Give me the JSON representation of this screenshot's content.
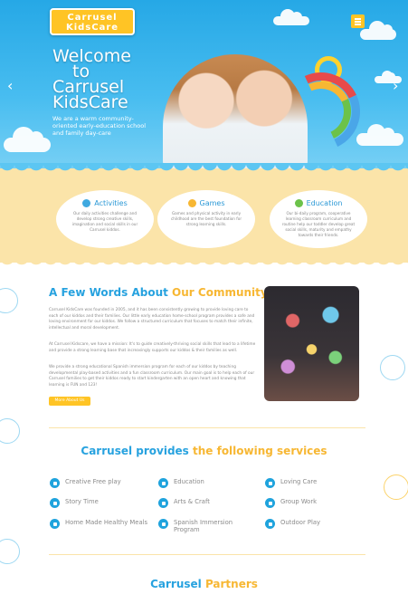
{
  "header": {
    "logo_line1": "Carrusel",
    "logo_line2": "KidsCare"
  },
  "hero": {
    "title_lines": [
      "Welcome",
      "to",
      "Carrusel",
      "KidsCare"
    ],
    "subtitle": "We are a warm community-oriented early-education school and family day-care"
  },
  "features": [
    {
      "title": "Activities",
      "text": "Our daily activities challenge and develop strong creative skills, imagination and social skills in our Carrusel kiddos.",
      "color": "#3fa9e0"
    },
    {
      "title": "Games",
      "text": "Games and physical activity in early childhood are the best foundation for strong learning skills.",
      "color": "#f7b733"
    },
    {
      "title": "Education",
      "text": "Our bi-daily program, cooperative learning classroom curriculum and routine help our toddler develop great social skills, maturity and empathy towards their friends.",
      "color": "#6cc24a"
    }
  ],
  "about": {
    "title_start": "A Few Words About ",
    "title_highlight": "Our Community",
    "paragraphs": [
      "Carrusel KidsCare was founded in 2005, and it has been consistently growing to provide loving care to each of our kiddos and their families. Our little early education home-school program provides a safe and loving environment for our kiddos. We follow a structured curriculum that focuses to match their infinite, intellectual and moral development.",
      "At Carrusel Kidscare, we have a mission: It's to guide creatively-thriving social skills that lead to a lifetime and provide a strong learning base that increasingly supports our kiddos & their families as well.",
      "We provide a strong educational Spanish immersion program for each of our kiddos by teaching developmental play-based activities and a fun classroom curriculum. Our main goal is to help each of our Carrusel families to get their kiddos ready to start kindergarten with an open heart and knowing that learning is FUN and 123!"
    ],
    "button": "More About Us"
  },
  "services": {
    "title_start": "Carrusel provides ",
    "title_highlight": "the following services",
    "items": [
      "Creative Free play",
      "Story Time",
      "Home Made Healthy Meals",
      "Education",
      "Arts & Craft",
      "Spanish Immersion Program",
      "Loving Care",
      "Group Work",
      "Outdoor Play"
    ]
  },
  "partners": {
    "title_start": "Carrusel ",
    "title_highlight": "Partners"
  },
  "colors": {
    "primary_blue": "#27a2df",
    "accent_yellow": "#ffc425",
    "sand": "#fbe4a9"
  }
}
